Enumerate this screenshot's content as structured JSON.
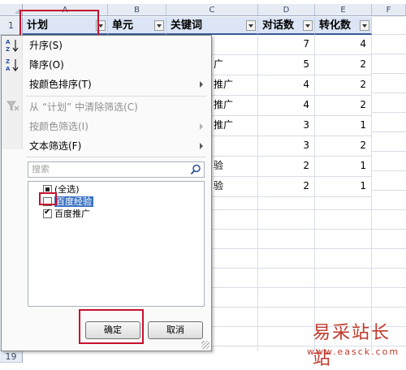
{
  "grid": {
    "col_letters": [
      "A",
      "B",
      "C",
      "D",
      "E",
      "F"
    ],
    "row_numbers": [
      "1",
      "19"
    ],
    "headers": [
      {
        "label": "计划"
      },
      {
        "label": "单元"
      },
      {
        "label": "关键词"
      },
      {
        "label": "对话数"
      },
      {
        "label": "转化数"
      }
    ],
    "keyword_fragments": [
      "",
      "广",
      "推广",
      "推广",
      "推广",
      "",
      "验",
      "验"
    ],
    "dialog_counts": [
      "7",
      "5",
      "4",
      "4",
      "3",
      "3",
      "2",
      "2"
    ],
    "conversion_counts": [
      "4",
      "2",
      "2",
      "2",
      "1",
      "2",
      "1",
      "1"
    ]
  },
  "dropdown": {
    "sort_ascending": "升序(S)",
    "sort_descending": "降序(O)",
    "sort_by_color": "按颜色排序(T)",
    "clear_filter": "从 “计划” 中清除筛选(C)",
    "filter_by_color": "按颜色筛选(I)",
    "text_filter": "文本筛选(F)",
    "search_placeholder": "搜索",
    "options": [
      {
        "label": "(全选)",
        "state": "mixed"
      },
      {
        "label": "百度经验",
        "state": "unchecked"
      },
      {
        "label": "百度推广",
        "state": "checked"
      }
    ],
    "ok_label": "确定",
    "cancel_label": "取消"
  },
  "highlight_color": "#c8102e",
  "watermark": {
    "name": "易采站长站",
    "url": "www.easck.com"
  }
}
